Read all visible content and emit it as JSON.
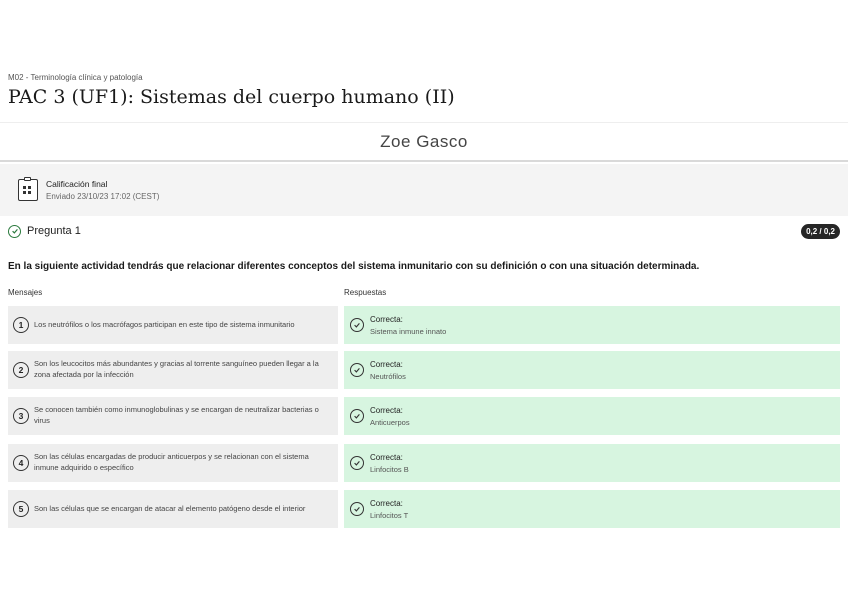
{
  "breadcrumb": "M02 - Terminología clínica y patología",
  "page_title": "PAC 3 (UF1): Sistemas del cuerpo humano (II)",
  "student_name": "Zoe Gasco",
  "grade": {
    "label": "Calificación final",
    "sent": "Enviado 23/10/23 17:02 (CEST)"
  },
  "question": {
    "label": "Pregunta 1",
    "score": "0,2 / 0,2",
    "instruction": "En la siguiente actividad tendrás que relacionar diferentes conceptos del sistema inmunitario con su definición o con una situación determinada."
  },
  "columns": {
    "messages": "Mensajes",
    "answers": "Respuestas"
  },
  "rows": [
    {
      "num": "1",
      "message": "Los neutrófilos o los macrófagos participan en este tipo de sistema inmunitario",
      "status": "Correcta:",
      "answer": "Sistema inmune innato"
    },
    {
      "num": "2",
      "message": "Son los leucocitos más abundantes y gracias al torrente sanguíneo pueden llegar a la zona afectada por la infección",
      "status": "Correcta:",
      "answer": "Neutrófilos"
    },
    {
      "num": "3",
      "message": "Se conocen también como inmunoglobulinas y se encargan de neutralizar bacterias o virus",
      "status": "Correcta:",
      "answer": "Anticuerpos"
    },
    {
      "num": "4",
      "message": "Son las células encargadas de producir anticuerpos y se relacionan con el sistema inmune adquirido o específico",
      "status": "Correcta:",
      "answer": "Linfocitos B"
    },
    {
      "num": "5",
      "message": "Son las células que se encargan de atacar al elemento patógeno desde el interior",
      "status": "Correcta:",
      "answer": "Linfocitos T"
    }
  ],
  "icons": {
    "grade": "clipboard-grade-icon",
    "check": "check-circle-icon"
  },
  "colors": {
    "correct_bg": "#d7f5e0",
    "message_bg": "#eeeeee",
    "badge_bg": "#262626",
    "check_green": "#2b7a3e"
  }
}
